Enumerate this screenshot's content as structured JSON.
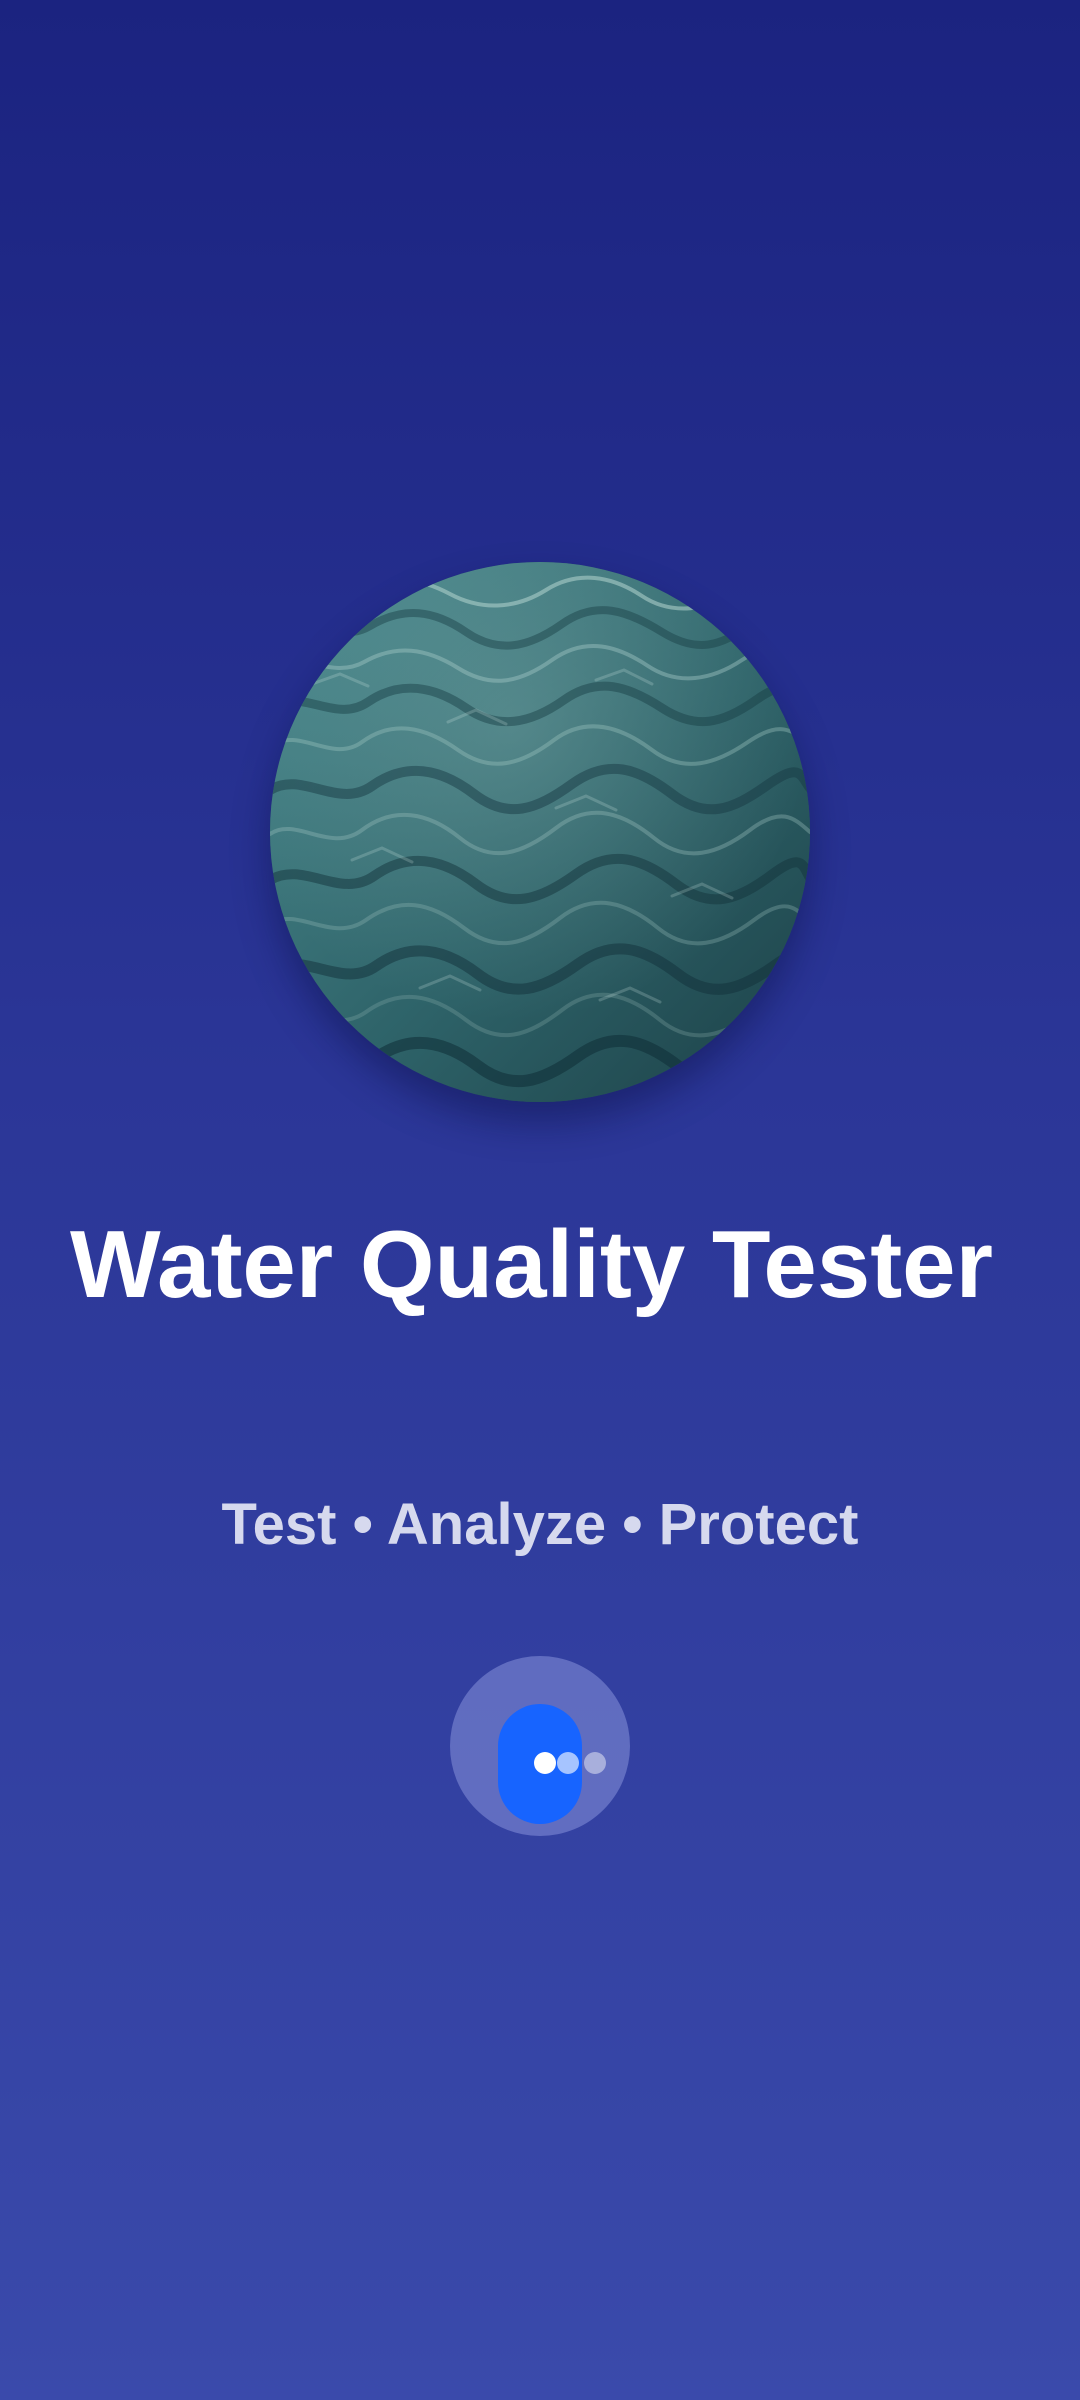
{
  "app": {
    "title": "Water Quality Tester",
    "tagline": "Test • Analyze • Protect"
  },
  "hero": {
    "image_icon": "water-surface-image"
  },
  "loader": {
    "icon": "loading-dots-icon"
  },
  "colors": {
    "background_top": "#1b2380",
    "background_bottom": "#3a4aab",
    "accent": "#1764ff",
    "title": "#ffffff",
    "tagline": "#d6d9ee"
  }
}
